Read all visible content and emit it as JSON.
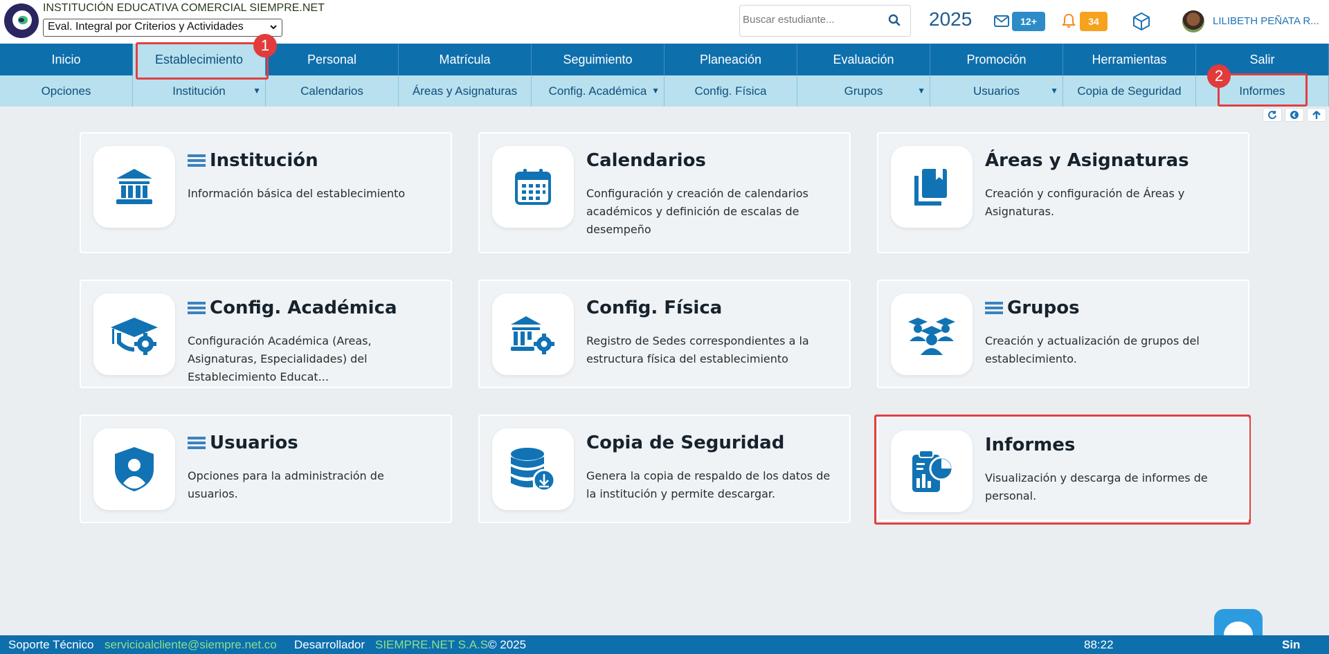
{
  "header": {
    "institution_name": "INSTITUCIÓN EDUCATIVA COMERCIAL SIEMPRE.NET",
    "eval_selected": "Eval. Integral por Criterios y Actividades",
    "search_placeholder": "Buscar estudiante...",
    "year": "2025",
    "mail_count": "12+",
    "notification_count": "34",
    "user_name": "LILIBETH PEÑATA R...",
    "colors": {
      "nav": "#0e6fad",
      "subnav": "#b8e0ee",
      "highlight": "#e04040"
    }
  },
  "nav_main": [
    "Inicio",
    "Establecimiento",
    "Personal",
    "Matrícula",
    "Seguimiento",
    "Planeación",
    "Evaluación",
    "Promoción",
    "Herramientas",
    "Salir"
  ],
  "nav_sub": [
    "Opciones",
    "Institución",
    "Calendarios",
    "Áreas y Asignaturas",
    "Config. Académica",
    "Config. Física",
    "Grupos",
    "Usuarios",
    "Copia de Seguridad",
    "Informes"
  ],
  "steps": [
    "1",
    "2"
  ],
  "cards": [
    {
      "title": "Institución",
      "desc": "Información básica del establecimiento",
      "icon": "bank-icon",
      "has_menu": true
    },
    {
      "title": "Calendarios",
      "desc": "Configuración y creación de calendarios académicos y definición de escalas de desempeño",
      "icon": "calendar-icon",
      "has_menu": false
    },
    {
      "title": "Áreas y Asignaturas",
      "desc": "Creación y configuración de Áreas y Asignaturas.",
      "icon": "book-icon",
      "has_menu": false
    },
    {
      "title": "Config. Académica",
      "desc": "Configuración Académica (Areas, Asignaturas, Especialidades) del Establecimiento Educat...",
      "icon": "graduation-gear-icon",
      "has_menu": true
    },
    {
      "title": "Config. Física",
      "desc": "Registro de Sedes correspondientes a la estructura física del establecimiento",
      "icon": "building-gear-icon",
      "has_menu": false
    },
    {
      "title": "Grupos",
      "desc": "Creación y actualización de grupos del establecimiento.",
      "icon": "group-icon",
      "has_menu": true
    },
    {
      "title": "Usuarios",
      "desc": "Opciones para la administración de usuarios.",
      "icon": "user-shield-icon",
      "has_menu": true
    },
    {
      "title": "Copia de Seguridad",
      "desc": "Genera la copia de respaldo de los datos de la institución y permite descargar.",
      "icon": "database-download-icon",
      "has_menu": false
    },
    {
      "title": "Informes",
      "desc": "Visualización y descarga de informes de personal.",
      "icon": "report-chart-icon",
      "has_menu": false
    }
  ],
  "footer": {
    "support_label": "Soporte Técnico",
    "support_email": "servicioalcliente@siempre.net.co",
    "dev_label": "Desarrollador",
    "dev_name": "SIEMPRE.NET S.A.S",
    "copyright": "© 2025",
    "timer": "88:22",
    "brand": "Sin"
  }
}
